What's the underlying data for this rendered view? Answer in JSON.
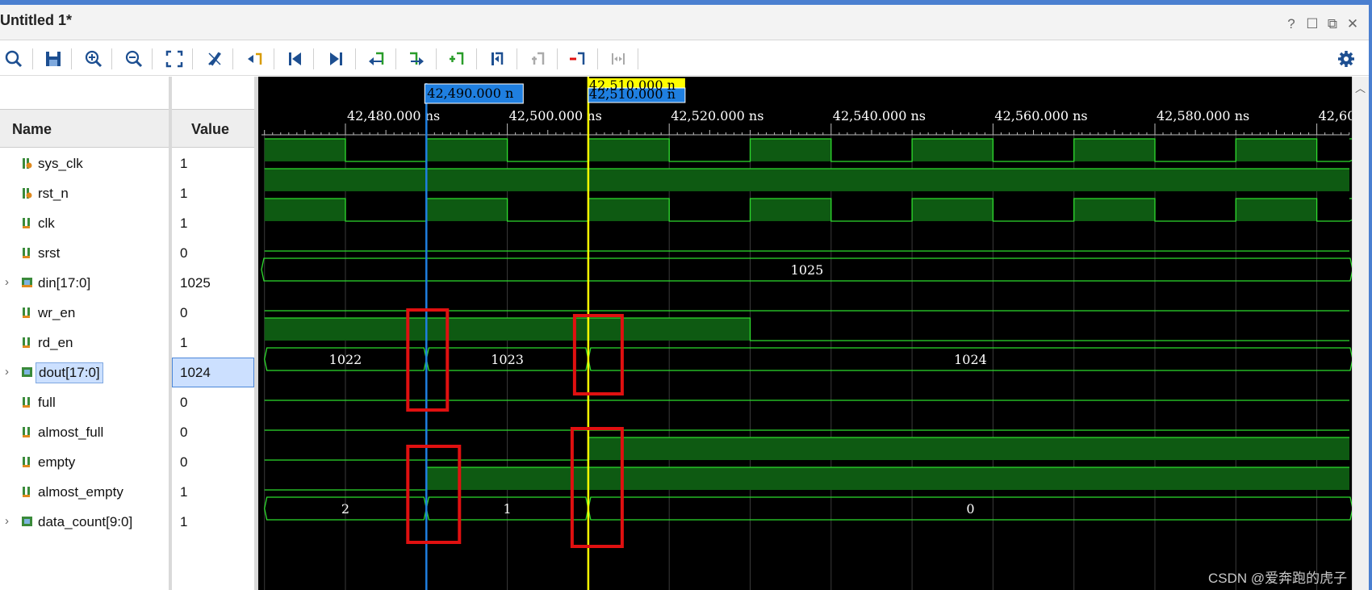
{
  "window": {
    "title": "Untitled 1*",
    "controls": [
      "help-icon",
      "maximize-icon",
      "float-icon",
      "close-icon"
    ],
    "control_glyphs": {
      "help": "?",
      "maximize": "☐",
      "float": "⧉",
      "close": "✕"
    }
  },
  "toolbar": {
    "buttons": [
      "search-icon",
      "save-icon",
      "zoom-in-icon",
      "zoom-out-icon",
      "zoom-fit-icon",
      "go-to-cursor-icon",
      "previous-transition-icon",
      "go-to-time-zero-icon",
      "go-to-last-time-icon",
      "previous-marker-icon",
      "next-marker-icon",
      "add-marker-icon",
      "swap-cursors-icon",
      "snap-to-transition-icon",
      "remove-marker-icon",
      "expand-icon",
      "settings-gear-icon"
    ]
  },
  "columns": {
    "name": "Name",
    "value": "Value"
  },
  "signals": [
    {
      "name": "sys_clk",
      "value": "1",
      "icon": "input-signal-icon",
      "bus": false
    },
    {
      "name": "rst_n",
      "value": "1",
      "icon": "input-signal-icon",
      "bus": false
    },
    {
      "name": "clk",
      "value": "1",
      "icon": "signal-icon",
      "bus": false
    },
    {
      "name": "srst",
      "value": "0",
      "icon": "signal-icon",
      "bus": false
    },
    {
      "name": "din[17:0]",
      "value": "1025",
      "icon": "bus-signal-icon",
      "bus": true
    },
    {
      "name": "wr_en",
      "value": "0",
      "icon": "signal-icon",
      "bus": false
    },
    {
      "name": "rd_en",
      "value": "1",
      "icon": "signal-icon",
      "bus": false
    },
    {
      "name": "dout[17:0]",
      "value": "1024",
      "icon": "output-bus-icon",
      "bus": true,
      "selected": true
    },
    {
      "name": "full",
      "value": "0",
      "icon": "signal-icon",
      "bus": false
    },
    {
      "name": "almost_full",
      "value": "0",
      "icon": "signal-icon",
      "bus": false
    },
    {
      "name": "empty",
      "value": "0",
      "icon": "signal-icon",
      "bus": false
    },
    {
      "name": "almost_empty",
      "value": "1",
      "icon": "signal-icon",
      "bus": false
    },
    {
      "name": "data_count[9:0]",
      "value": "1",
      "icon": "output-bus-icon",
      "bus": true
    }
  ],
  "timeline": {
    "ticks": [
      "42,480.000 ns",
      "42,500.000 ns",
      "42,520.000 ns",
      "42,540.000 ns",
      "42,560.000 ns",
      "42,580.000 ns",
      "42,60"
    ],
    "tick_ns": [
      42480,
      42500,
      42520,
      42540,
      42560,
      42580,
      42600
    ],
    "marker": {
      "label": "42,490.000 n",
      "time_ns": 42490,
      "color": "#1f7fe0"
    },
    "cursor": {
      "label": "42,510.000 n",
      "label_overlap": "42,510.000 n",
      "time_ns": 42510,
      "color": "#ffff00"
    }
  },
  "waveforms": {
    "bus_values": {
      "din": [
        "1025"
      ],
      "dout": [
        "1022",
        "1023",
        "1024"
      ],
      "data_count": [
        "2",
        "1",
        "0"
      ]
    }
  },
  "colors": {
    "wave_bg": "#000000",
    "wave_high_fill": "#0e5a12",
    "wave_line": "#2edc2e",
    "grid": "#3a3a3a",
    "highlight_box": "#e01010"
  },
  "watermark": "CSDN @爱奔跑的虎子"
}
